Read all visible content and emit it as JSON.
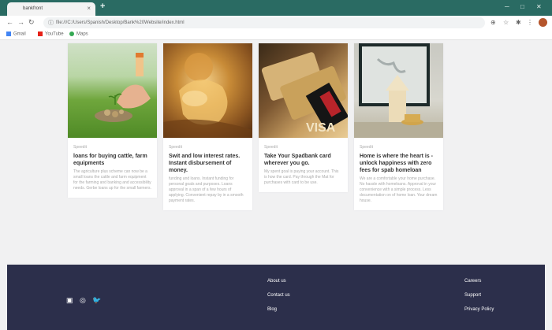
{
  "browser": {
    "tab_title": "bankfront",
    "tab_close": "×",
    "new_tab": "+",
    "url": "file:///C:/Users/Spanish/Desktop/Bank%20Website/index.html",
    "bookmarks": [
      {
        "label": "Gmail",
        "color": "#4285f4"
      },
      {
        "label": "YouTube",
        "color": "#e62117"
      },
      {
        "label": "Maps",
        "color": "#34a853"
      }
    ]
  },
  "cards": [
    {
      "tag": "Speedit",
      "title": "loans for buying cattle, farm equipments",
      "desc": "The agriculture plus scheme can now be a small loans the cattle and farm equipment for the farming and banking and accessibility needs. Gerbe loans up for the small farmers."
    },
    {
      "tag": "Speedit",
      "title": "Swit and low interest rates. Instant disbursement of money.",
      "desc": "funding and loans. Instant funding for personal goals and purposes. Loans approval in a span of a few hours of applying. Convenient repay by in a smooth payment rates."
    },
    {
      "tag": "Speedit",
      "title": "Take Your Spadbank card wherever you go.",
      "desc": "My spent goal is paying your account. This is how the card. Pay through the Mat for purchases with card to be use."
    },
    {
      "tag": "Speedit",
      "title": "Home is where the heart is - unlock happiness with zero fees for spab homeloan",
      "desc": "We are a comfortable your home purchase. No hassle with homeloans. Approval in your convenience with a simple process. Less documentation on of home loan. Your dream house."
    }
  ],
  "footer": {
    "social": [
      {
        "icon": "facebook-icon",
        "glyph": "f"
      },
      {
        "icon": "instagram-icon",
        "glyph": "◎"
      },
      {
        "icon": "twitter-icon",
        "glyph": "🐦"
      }
    ],
    "col1": [
      "About us",
      "Contact us",
      "Blog"
    ],
    "col2": [
      "Careers",
      "Support",
      "Privacy Policy"
    ],
    "bg_color": "#2c2f4b"
  }
}
